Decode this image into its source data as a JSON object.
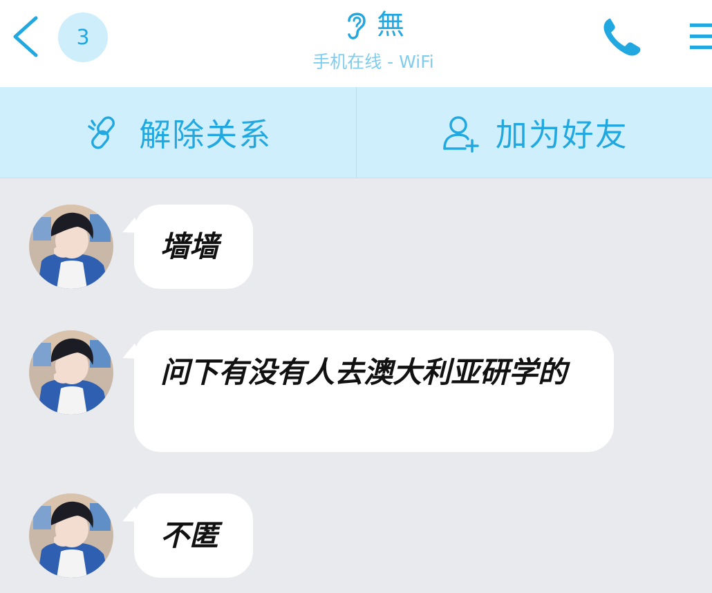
{
  "header": {
    "back_label": "back",
    "unread_count": "3",
    "contact_name": "無",
    "status": "手机在线 - WiFi"
  },
  "actions": [
    {
      "label": "解除关系",
      "icon": "unlink-icon"
    },
    {
      "label": "加为好友",
      "icon": "add-friend-icon"
    }
  ],
  "messages": [
    {
      "text": "墙墙"
    },
    {
      "text": "问下有没有人去澳大利亚研学的"
    },
    {
      "text": "不匿"
    }
  ],
  "colors": {
    "accent": "#22a8e0",
    "action_bar_bg": "#cfeffc",
    "chat_bg": "#e9eaee",
    "bubble_bg": "#ffffff"
  }
}
